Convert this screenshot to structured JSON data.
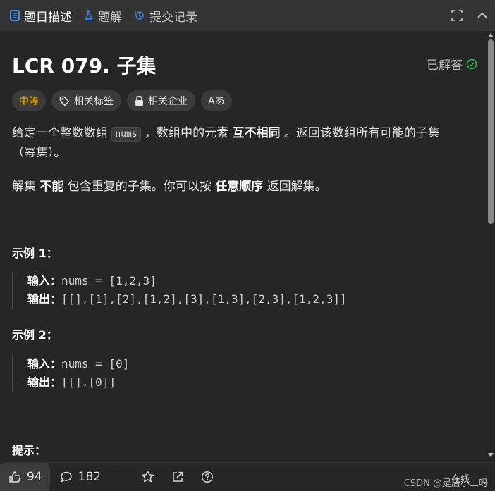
{
  "tabs": {
    "description": "题目描述",
    "solutions": "题解",
    "submissions": "提交记录"
  },
  "problem": {
    "title": "LCR 079. 子集",
    "status": "已解答",
    "difficulty": "中等",
    "tags_label": "相关标签",
    "companies_label": "相关企业",
    "translate_label": "Aあ"
  },
  "desc": {
    "p1_a": "给定一个整数数组 ",
    "p1_code": "nums",
    "p1_b": " ，数组中的元素 ",
    "p1_bold": "互不相同",
    "p1_c": " 。返回该数组所有可能的子集（幂集）。",
    "p2_a": "解集 ",
    "p2_bold1": "不能",
    "p2_b": " 包含重复的子集。你可以按 ",
    "p2_bold2": "任意顺序",
    "p2_c": " 返回解集。"
  },
  "examples": [
    {
      "heading": "示例 1：",
      "input_label": "输入：",
      "input": "nums = [1,2,3]",
      "output_label": "输出：",
      "output": "[[],[1],[2],[1,2],[3],[1,3],[2,3],[1,2,3]]"
    },
    {
      "heading": "示例 2：",
      "input_label": "输入：",
      "input": "nums = [0]",
      "output_label": "输出：",
      "output": "[[],[0]]"
    }
  ],
  "hints_heading": "提示：",
  "bottom": {
    "likes": "94",
    "comments": "182",
    "online": "在线",
    "watermark": "CSDN @是店小二呀"
  },
  "colors": {
    "difficulty": "#ffb800",
    "solved_check": "#2cbb5d",
    "tab_active_icon": "#4a90e2"
  }
}
